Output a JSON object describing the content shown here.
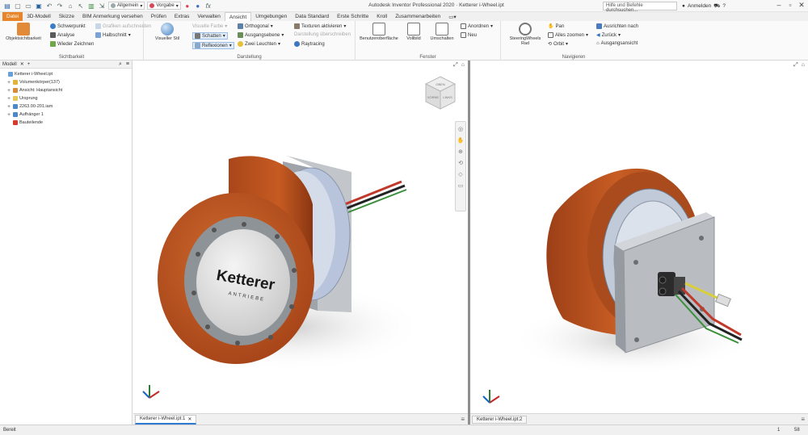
{
  "app": {
    "title": "Autodesk Inventor Professional 2020 · Ketterer i-Wheel.ipt",
    "help_placeholder": "Hilfe und Befehle durchsuchen...",
    "signin": "Anmelden",
    "qat": {
      "material": "Allgemein",
      "appearance": "Vorgabe"
    }
  },
  "tabs": [
    "Datei",
    "3D-Modell",
    "Skizze",
    "BIM Anmerkung versehen",
    "Prüfen",
    "Extras",
    "Verwalten",
    "Ansicht",
    "Umgebungen",
    "Data Standard",
    "Erste Schritte",
    "Kroll",
    "Zusammenarbeiten"
  ],
  "active_tab": "Ansicht",
  "ribbon": {
    "sichtbarkeit": {
      "title": "Sichtbarkeit",
      "objekt": "Objektsichtbarkeit",
      "schwerpunkt": "Schwerpunkt",
      "analyse": "Analyse",
      "wieder": "Wieder Zeichnen",
      "grafiken": "Grafiken aufschneiden",
      "halbschnitt": "Halbschnitt"
    },
    "darstellung": {
      "title": "Darstellung",
      "visueller_stil": "Visueller Stil",
      "visuelle_farbe": "Visuelle Farbe",
      "schatten": "Schatten",
      "reflexionen": "Reflexionen",
      "orthogonal": "Orthogonal",
      "ausgangsebene": "Ausgangsebene",
      "zwei_leuchten": "Zwei Leuchten",
      "texturen": "Texturen aktivieren",
      "darstellung_ueberschr": "Darstellung überschreiben",
      "raytracing": "Raytracing"
    },
    "fenster": {
      "title": "Fenster",
      "benutzeroberflaeche": "Benutzeroberfläche",
      "vollbild": "Vollbild",
      "umschalten": "Umschalten",
      "anordnen": "Anordnen",
      "neu": "Neu"
    },
    "navigieren": {
      "title": "Navigieren",
      "steering": "SteeringWheels",
      "steering_sub": "Rad",
      "pan": "Pan",
      "alles": "Alles zoomen",
      "orbit": "Orbit",
      "ausrichten": "Ausrichten nach",
      "zurueck": "Zurück",
      "ausgang": "Ausgangsansicht"
    }
  },
  "browser": {
    "tab": "Modell",
    "nodes": [
      {
        "label": "Ketterer i-Wheel.ipt",
        "level": 0,
        "icon_color": "#6aa0d8",
        "expand": ""
      },
      {
        "label": "Volumenkörper(137)",
        "level": 1,
        "icon_color": "#e3b23c",
        "expand": "+"
      },
      {
        "label": "Ansicht: Hauptansicht",
        "level": 1,
        "icon_color": "#d98a3a",
        "expand": "+"
      },
      {
        "label": "Ursprung",
        "level": 1,
        "icon_color": "#e9c65a",
        "expand": "+"
      },
      {
        "label": "2263.00-201.iam",
        "level": 1,
        "icon_color": "#4d88c9",
        "expand": "+"
      },
      {
        "label": "Aufhänger 1",
        "level": 1,
        "icon_color": "#4d88c9",
        "expand": "+"
      },
      {
        "label": "Bauteilende",
        "level": 1,
        "icon_color": "#d63b2f",
        "expand": ""
      }
    ]
  },
  "viewports": {
    "left_tab": "Ketterer i-Wheel.ipt:1",
    "right_tab": "Ketterer i-Wheel.ipt:2",
    "brand": "Ketterer",
    "brand_sub": "ANTRIEBE"
  },
  "viewcube": {
    "front": "VORNE",
    "left": "LINKS",
    "top": "OBEN"
  },
  "status": {
    "text": "Bereit",
    "count1": "1",
    "count2": "58"
  },
  "colors": {
    "tire": "#c2571f",
    "tire_dark": "#8e3a12",
    "hub": "#9aa3ad",
    "plate": "#b4b8bd",
    "file_tab": "#e8852a"
  }
}
